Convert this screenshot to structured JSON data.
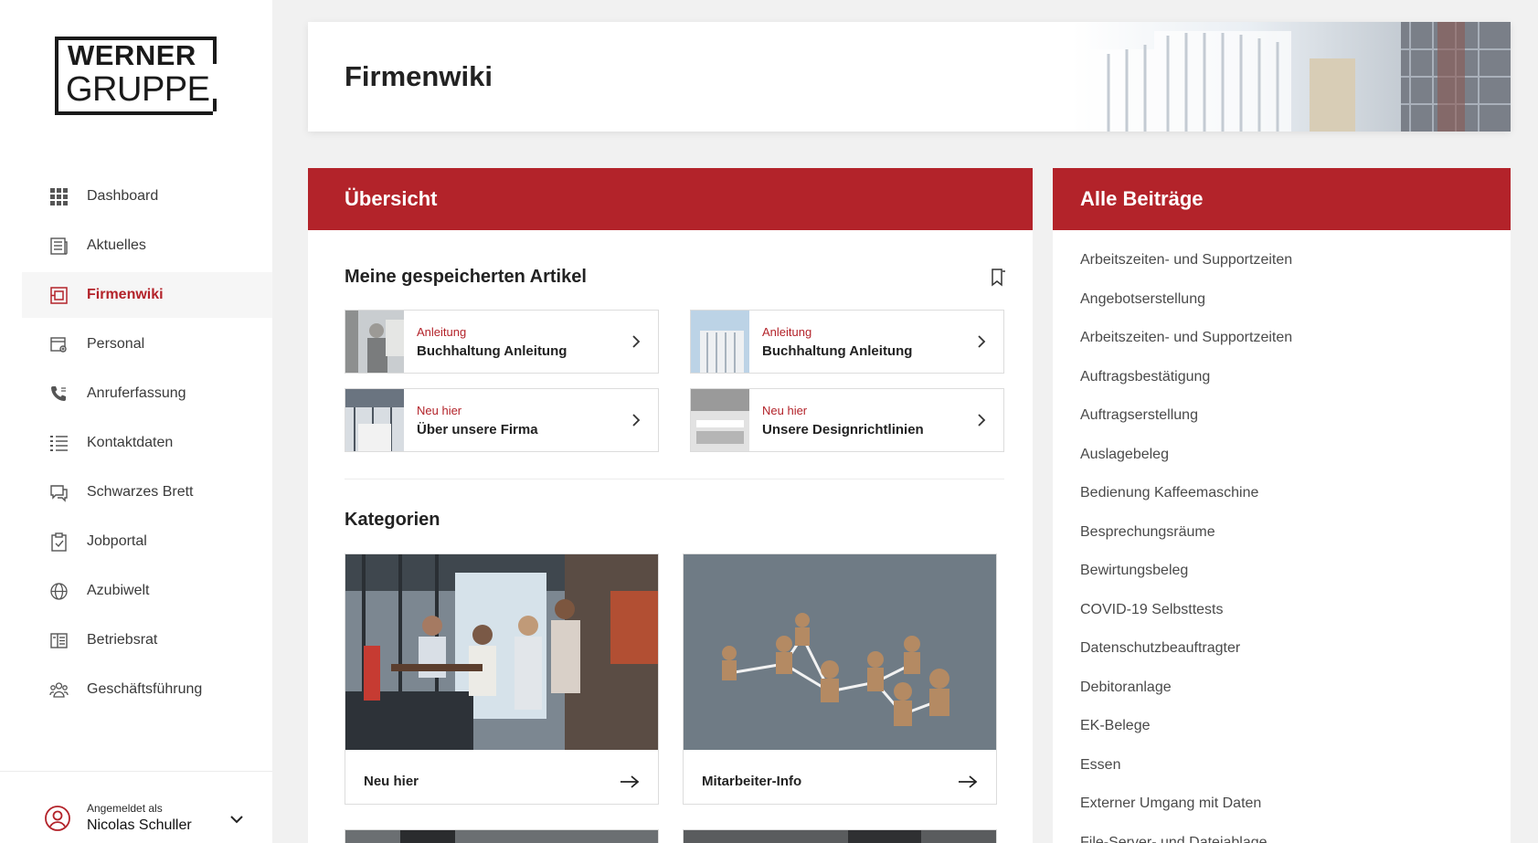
{
  "brand": {
    "line1": "WERNER",
    "line2": "GRUPPE"
  },
  "colors": {
    "accent": "#b3232a",
    "background": "#f1f1f1"
  },
  "sidebar": {
    "items": [
      {
        "label": "Dashboard",
        "icon": "grid-icon",
        "active": false
      },
      {
        "label": "Aktuelles",
        "icon": "newspaper-icon",
        "active": false
      },
      {
        "label": "Firmenwiki",
        "icon": "wiki-icon",
        "active": true
      },
      {
        "label": "Personal",
        "icon": "calendar-user-icon",
        "active": false
      },
      {
        "label": "Anruferfassung",
        "icon": "phone-icon",
        "active": false
      },
      {
        "label": "Kontaktdaten",
        "icon": "list-icon",
        "active": false
      },
      {
        "label": "Schwarzes Brett",
        "icon": "chat-icon",
        "active": false
      },
      {
        "label": "Jobportal",
        "icon": "clipboard-icon",
        "active": false
      },
      {
        "label": "Azubiwelt",
        "icon": "globe-icon",
        "active": false
      },
      {
        "label": "Betriebsrat",
        "icon": "book-list-icon",
        "active": false
      },
      {
        "label": "Geschäftsführung",
        "icon": "team-icon",
        "active": false
      }
    ],
    "user": {
      "sublabel": "Angemeldet als",
      "name": "Nicolas Schuller"
    }
  },
  "header": {
    "title": "Firmenwiki"
  },
  "overview": {
    "title": "Übersicht",
    "saved_title": "Meine gespeicherten Artikel",
    "saved": [
      {
        "category": "Anleitung",
        "title": "Buchhaltung Anleitung"
      },
      {
        "category": "Anleitung",
        "title": "Buchhaltung Anleitung"
      },
      {
        "category": "Neu hier",
        "title": "Über unsere Firma"
      },
      {
        "category": "Neu hier",
        "title": "Unsere Designrichtlinien"
      }
    ],
    "categories_title": "Kategorien",
    "categories": [
      {
        "label": "Neu hier"
      },
      {
        "label": "Mitarbeiter-Info"
      }
    ]
  },
  "all_posts": {
    "title": "Alle Beiträge",
    "items": [
      "Arbeitszeiten- und Supportzeiten",
      "Angebotserstellung",
      "Arbeitszeiten- und Supportzeiten",
      "Auftragsbestätigung",
      "Auftragserstellung",
      "Auslagebeleg",
      "Bedienung Kaffeemaschine",
      "Besprechungsräume",
      "Bewirtungsbeleg",
      "COVID-19 Selbsttests",
      "Datenschutzbeauftragter",
      "Debitoranlage",
      "EK-Belege",
      "Essen",
      "Externer Umgang mit Daten",
      "File-Server- und Dateiablage"
    ]
  }
}
